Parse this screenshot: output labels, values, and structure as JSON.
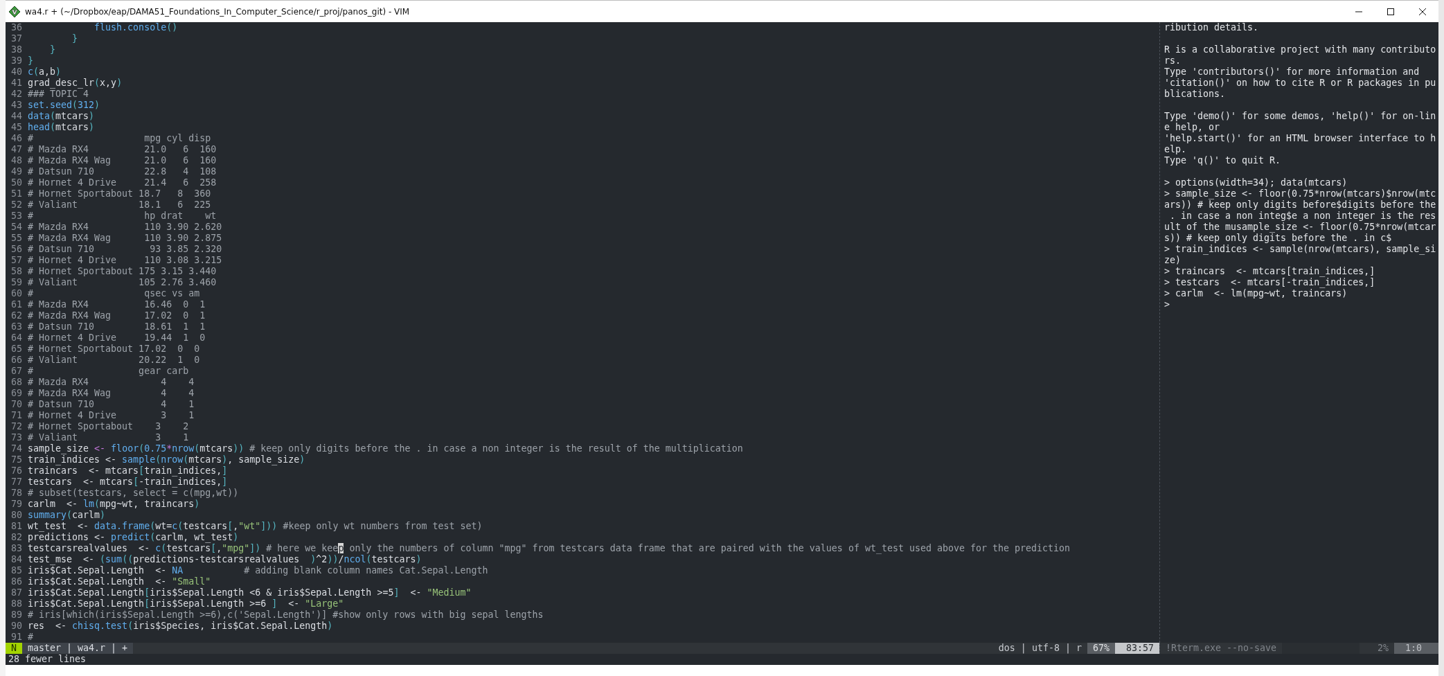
{
  "window": {
    "title": "wa4.r + (~/Dropbox/eap/DAMA51_Foundations_In_Computer_Science/r_proj/panos_git) - VIM"
  },
  "editor": {
    "lines": [
      {
        "number": "36",
        "segments": [
          {
            "kind": "function",
            "text": "            flush.console"
          },
          {
            "kind": "bracket",
            "text": "()"
          }
        ]
      },
      {
        "number": "37",
        "segments": [
          {
            "kind": "bracket",
            "text": "        }"
          }
        ]
      },
      {
        "number": "38",
        "segments": [
          {
            "kind": "bracket",
            "text": "    }"
          }
        ]
      },
      {
        "number": "39",
        "segments": [
          {
            "kind": "bracket",
            "text": "}"
          }
        ]
      },
      {
        "number": "40",
        "segments": [
          {
            "kind": "function",
            "text": "c"
          },
          {
            "kind": "bracket",
            "text": "("
          },
          {
            "kind": "plain",
            "text": "a,b"
          },
          {
            "kind": "bracket",
            "text": ")"
          }
        ]
      },
      {
        "number": "41",
        "segments": [
          {
            "kind": "plain",
            "text": "grad_desc_lr"
          },
          {
            "kind": "bracket",
            "text": "("
          },
          {
            "kind": "plain",
            "text": "x,y"
          },
          {
            "kind": "bracket",
            "text": ")"
          }
        ]
      },
      {
        "number": "42",
        "segments": [
          {
            "kind": "comment",
            "text": "### TOPIC 4"
          }
        ]
      },
      {
        "number": "43",
        "segments": [
          {
            "kind": "function",
            "text": "set.seed"
          },
          {
            "kind": "bracket",
            "text": "("
          },
          {
            "kind": "number",
            "text": "312"
          },
          {
            "kind": "bracket",
            "text": ")"
          }
        ]
      },
      {
        "number": "44",
        "segments": [
          {
            "kind": "function",
            "text": "data"
          },
          {
            "kind": "bracket",
            "text": "("
          },
          {
            "kind": "plain",
            "text": "mtcars"
          },
          {
            "kind": "bracket",
            "text": ")"
          }
        ]
      },
      {
        "number": "45",
        "segments": [
          {
            "kind": "function",
            "text": "head"
          },
          {
            "kind": "bracket",
            "text": "("
          },
          {
            "kind": "plain",
            "text": "mtcars"
          },
          {
            "kind": "bracket",
            "text": ")"
          }
        ]
      },
      {
        "number": "46",
        "segments": [
          {
            "kind": "comment",
            "text": "#                    mpg cyl disp"
          }
        ]
      },
      {
        "number": "47",
        "segments": [
          {
            "kind": "comment",
            "text": "# Mazda RX4          21.0   6  160"
          }
        ]
      },
      {
        "number": "48",
        "segments": [
          {
            "kind": "comment",
            "text": "# Mazda RX4 Wag      21.0   6  160"
          }
        ]
      },
      {
        "number": "49",
        "segments": [
          {
            "kind": "comment",
            "text": "# Datsun 710         22.8   4  108"
          }
        ]
      },
      {
        "number": "50",
        "segments": [
          {
            "kind": "comment",
            "text": "# Hornet 4 Drive     21.4   6  258"
          }
        ]
      },
      {
        "number": "51",
        "segments": [
          {
            "kind": "comment",
            "text": "# Hornet Sportabout 18.7   8  360"
          }
        ]
      },
      {
        "number": "52",
        "segments": [
          {
            "kind": "comment",
            "text": "# Valiant           18.1   6  225"
          }
        ]
      },
      {
        "number": "53",
        "segments": [
          {
            "kind": "comment",
            "text": "#                    hp drat    wt"
          }
        ]
      },
      {
        "number": "54",
        "segments": [
          {
            "kind": "comment",
            "text": "# Mazda RX4          110 3.90 2.620"
          }
        ]
      },
      {
        "number": "55",
        "segments": [
          {
            "kind": "comment",
            "text": "# Mazda RX4 Wag      110 3.90 2.875"
          }
        ]
      },
      {
        "number": "56",
        "segments": [
          {
            "kind": "comment",
            "text": "# Datsun 710          93 3.85 2.320"
          }
        ]
      },
      {
        "number": "57",
        "segments": [
          {
            "kind": "comment",
            "text": "# Hornet 4 Drive     110 3.08 3.215"
          }
        ]
      },
      {
        "number": "58",
        "segments": [
          {
            "kind": "comment",
            "text": "# Hornet Sportabout 175 3.15 3.440"
          }
        ]
      },
      {
        "number": "59",
        "segments": [
          {
            "kind": "comment",
            "text": "# Valiant           105 2.76 3.460"
          }
        ]
      },
      {
        "number": "60",
        "segments": [
          {
            "kind": "comment",
            "text": "#                    qsec vs am"
          }
        ]
      },
      {
        "number": "61",
        "segments": [
          {
            "kind": "comment",
            "text": "# Mazda RX4          16.46  0  1"
          }
        ]
      },
      {
        "number": "62",
        "segments": [
          {
            "kind": "comment",
            "text": "# Mazda RX4 Wag      17.02  0  1"
          }
        ]
      },
      {
        "number": "63",
        "segments": [
          {
            "kind": "comment",
            "text": "# Datsun 710         18.61  1  1"
          }
        ]
      },
      {
        "number": "64",
        "segments": [
          {
            "kind": "comment",
            "text": "# Hornet 4 Drive     19.44  1  0"
          }
        ]
      },
      {
        "number": "65",
        "segments": [
          {
            "kind": "comment",
            "text": "# Hornet Sportabout 17.02  0  0"
          }
        ]
      },
      {
        "number": "66",
        "segments": [
          {
            "kind": "comment",
            "text": "# Valiant           20.22  1  0"
          }
        ]
      },
      {
        "number": "67",
        "segments": [
          {
            "kind": "comment",
            "text": "#                   gear carb"
          }
        ]
      },
      {
        "number": "68",
        "segments": [
          {
            "kind": "comment",
            "text": "# Mazda RX4             4    4"
          }
        ]
      },
      {
        "number": "69",
        "segments": [
          {
            "kind": "comment",
            "text": "# Mazda RX4 Wag         4    4"
          }
        ]
      },
      {
        "number": "70",
        "segments": [
          {
            "kind": "comment",
            "text": "# Datsun 710            4    1"
          }
        ]
      },
      {
        "number": "71",
        "segments": [
          {
            "kind": "comment",
            "text": "# Hornet 4 Drive        3    1"
          }
        ]
      },
      {
        "number": "72",
        "segments": [
          {
            "kind": "comment",
            "text": "# Hornet Sportabout    3    2"
          }
        ]
      },
      {
        "number": "73",
        "segments": [
          {
            "kind": "comment",
            "text": "# Valiant              3    1"
          }
        ]
      },
      {
        "number": "74",
        "segments": [
          {
            "kind": "plain",
            "text": "sample_size "
          },
          {
            "kind": "operator",
            "text": "<-"
          },
          {
            "kind": "function",
            "text": " floor"
          },
          {
            "kind": "bracket",
            "text": "("
          },
          {
            "kind": "number",
            "text": "0.75"
          },
          {
            "kind": "operator",
            "text": "*"
          },
          {
            "kind": "function",
            "text": "nrow"
          },
          {
            "kind": "bracket",
            "text": "("
          },
          {
            "kind": "plain",
            "text": "mtcars"
          },
          {
            "kind": "bracket",
            "text": "))"
          },
          {
            "kind": "comment",
            "text": " # keep only digits before the . in case a non integer is the result of the multiplication"
          }
        ]
      },
      {
        "number": "75",
        "segments": [
          {
            "kind": "plain",
            "text": "train_indices <- "
          },
          {
            "kind": "function",
            "text": "sample"
          },
          {
            "kind": "bracket",
            "text": "("
          },
          {
            "kind": "function",
            "text": "nrow"
          },
          {
            "kind": "bracket",
            "text": "("
          },
          {
            "kind": "plain",
            "text": "mtcars"
          },
          {
            "kind": "bracket",
            "text": ")"
          },
          {
            "kind": "plain",
            "text": ", sample_size"
          },
          {
            "kind": "bracket",
            "text": ")"
          }
        ]
      },
      {
        "number": "76",
        "segments": [
          {
            "kind": "plain",
            "text": "traincars  <- mtcars"
          },
          {
            "kind": "bracket",
            "text": "["
          },
          {
            "kind": "plain",
            "text": "train_indices,"
          },
          {
            "kind": "bracket",
            "text": "]"
          }
        ]
      },
      {
        "number": "77",
        "segments": [
          {
            "kind": "plain",
            "text": "testcars  <- mtcars"
          },
          {
            "kind": "bracket",
            "text": "["
          },
          {
            "kind": "plain",
            "text": "-train_indices,"
          },
          {
            "kind": "bracket",
            "text": "]"
          }
        ]
      },
      {
        "number": "78",
        "segments": [
          {
            "kind": "comment",
            "text": "# subset(testcars, select = c(mpg,wt))"
          }
        ]
      },
      {
        "number": "79",
        "segments": [
          {
            "kind": "plain",
            "text": "carlm  <- "
          },
          {
            "kind": "function",
            "text": "lm"
          },
          {
            "kind": "bracket",
            "text": "("
          },
          {
            "kind": "plain",
            "text": "mpg~wt, traincars"
          },
          {
            "kind": "bracket",
            "text": ")"
          }
        ]
      },
      {
        "number": "80",
        "segments": [
          {
            "kind": "function",
            "text": "summary"
          },
          {
            "kind": "bracket",
            "text": "("
          },
          {
            "kind": "plain",
            "text": "carlm"
          },
          {
            "kind": "bracket",
            "text": ")"
          }
        ]
      },
      {
        "number": "81",
        "segments": [
          {
            "kind": "plain",
            "text": "wt_test  <- "
          },
          {
            "kind": "function",
            "text": "data.frame"
          },
          {
            "kind": "bracket",
            "text": "("
          },
          {
            "kind": "plain",
            "text": "wt="
          },
          {
            "kind": "function",
            "text": "c"
          },
          {
            "kind": "bracket",
            "text": "("
          },
          {
            "kind": "plain",
            "text": "testcars"
          },
          {
            "kind": "bracket",
            "text": "["
          },
          {
            "kind": "plain",
            "text": ","
          },
          {
            "kind": "string",
            "text": "\"wt\""
          },
          {
            "kind": "bracket",
            "text": "]))"
          },
          {
            "kind": "comment",
            "text": " #keep only wt numbers from test set)"
          }
        ]
      },
      {
        "number": "82",
        "segments": [
          {
            "kind": "plain",
            "text": "predictions <- "
          },
          {
            "kind": "function",
            "text": "predict"
          },
          {
            "kind": "bracket",
            "text": "("
          },
          {
            "kind": "plain",
            "text": "carlm, wt_test"
          },
          {
            "kind": "bracket",
            "text": ")"
          }
        ]
      },
      {
        "number": "83",
        "segments": [
          {
            "kind": "plain",
            "text": "testcarsrealvalues  <- "
          },
          {
            "kind": "function",
            "text": "c"
          },
          {
            "kind": "bracket",
            "text": "("
          },
          {
            "kind": "plain",
            "text": "testcars"
          },
          {
            "kind": "bracket",
            "text": "["
          },
          {
            "kind": "plain",
            "text": ","
          },
          {
            "kind": "string",
            "text": "\"mpg\""
          },
          {
            "kind": "bracket",
            "text": "])"
          },
          {
            "kind": "comment",
            "text": " # here we kee"
          },
          {
            "kind": "cursor",
            "text": "p"
          },
          {
            "kind": "comment",
            "text": " only the numbers of column \"mpg\" from testcars data frame that are paired with the values of wt_test used above for the prediction"
          }
        ]
      },
      {
        "number": "84",
        "segments": [
          {
            "kind": "plain",
            "text": "test_mse  <- "
          },
          {
            "kind": "bracket",
            "text": "("
          },
          {
            "kind": "function",
            "text": "sum"
          },
          {
            "kind": "bracket",
            "text": "(("
          },
          {
            "kind": "plain",
            "text": "predictions-testcarsrealvalues  "
          },
          {
            "kind": "bracket",
            "text": ")"
          },
          {
            "kind": "plain",
            "text": "^2"
          },
          {
            "kind": "bracket",
            "text": "))"
          },
          {
            "kind": "plain",
            "text": "/"
          },
          {
            "kind": "function",
            "text": "ncol"
          },
          {
            "kind": "bracket",
            "text": "("
          },
          {
            "kind": "plain",
            "text": "testcars"
          },
          {
            "kind": "bracket",
            "text": ")"
          }
        ]
      },
      {
        "number": "85",
        "segments": [
          {
            "kind": "plain",
            "text": "iris$Cat.Sepal.Length  <- "
          },
          {
            "kind": "number",
            "text": "NA"
          },
          {
            "kind": "comment",
            "text": "           # adding blank column names Cat.Sepal.Length"
          }
        ]
      },
      {
        "number": "86",
        "segments": [
          {
            "kind": "plain",
            "text": "iris$Cat.Sepal.Length  <- "
          },
          {
            "kind": "string",
            "text": "\"Small\""
          }
        ]
      },
      {
        "number": "87",
        "segments": [
          {
            "kind": "plain",
            "text": "iris$Cat.Sepal.Length"
          },
          {
            "kind": "bracket",
            "text": "["
          },
          {
            "kind": "plain",
            "text": "iris$Sepal.Length <6 & iris$Sepal.Length >=5"
          },
          {
            "kind": "bracket",
            "text": "]"
          },
          {
            "kind": "plain",
            "text": "  <- "
          },
          {
            "kind": "string",
            "text": "\"Medium\""
          }
        ]
      },
      {
        "number": "88",
        "segments": [
          {
            "kind": "plain",
            "text": "iris$Cat.Sepal.Length"
          },
          {
            "kind": "bracket",
            "text": "["
          },
          {
            "kind": "plain",
            "text": "iris$Sepal.Length >=6 "
          },
          {
            "kind": "bracket",
            "text": "]"
          },
          {
            "kind": "plain",
            "text": "  <- "
          },
          {
            "kind": "string",
            "text": "\"Large\""
          }
        ]
      },
      {
        "number": "89",
        "segments": [
          {
            "kind": "comment",
            "text": "# iris[which(iris$Sepal.Length >=6),c('Sepal.Length')] #show only rows with big sepal lengths"
          }
        ]
      },
      {
        "number": "90",
        "segments": [
          {
            "kind": "plain",
            "text": "res  <- "
          },
          {
            "kind": "function",
            "text": "chisq.test"
          },
          {
            "kind": "bracket",
            "text": "("
          },
          {
            "kind": "plain",
            "text": "iris$Species, iris$Cat.Sepal.Length"
          },
          {
            "kind": "bracket",
            "text": ")"
          }
        ]
      },
      {
        "number": "91",
        "segments": [
          {
            "kind": "comment",
            "text": "#"
          }
        ]
      }
    ]
  },
  "console": {
    "paragraphs": [
      [
        "ribution details."
      ],
      [
        "R is a collaborative project with many contributo",
        "rs.",
        "Type 'contributors()' for more information and",
        "'citation()' on how to cite R or R packages in pu",
        "blications."
      ],
      [
        "Type 'demo()' for some demos, 'help()' for on-lin",
        "e help, or",
        "'help.start()' for an HTML browser interface to h",
        "elp.",
        "Type 'q()' to quit R."
      ],
      [
        "> options(width=34); data(mtcars)",
        "> sample_size <- floor(0.75*nrow(mtcars)$nrow(mtc",
        "ars)) # keep only digits before$digits before the",
        " . in case a non integ$e a non integer is the res",
        "ult of the musample_size <- floor(0.75*nrow(mtcar",
        "s)) # keep only digits before the . in c$",
        "> train_indices <- sample(nrow(mtcars), sample_si",
        "ze)",
        "> traincars  <- mtcars[train_indices,]",
        "> testcars  <- mtcars[-train_indices,]",
        "> carlm  <- lm(mpg~wt, traincars)",
        ">"
      ]
    ]
  },
  "status_bar": {
    "mode": "N",
    "branch_file": "master | wa4.r | +",
    "file_info": "dos | utf-8 | r",
    "percent": "67%",
    "position": "83:57",
    "console_title": "!Rterm.exe --no-save",
    "console_percent": "2%",
    "console_position": "1:0"
  },
  "command_line": "28 fewer lines"
}
